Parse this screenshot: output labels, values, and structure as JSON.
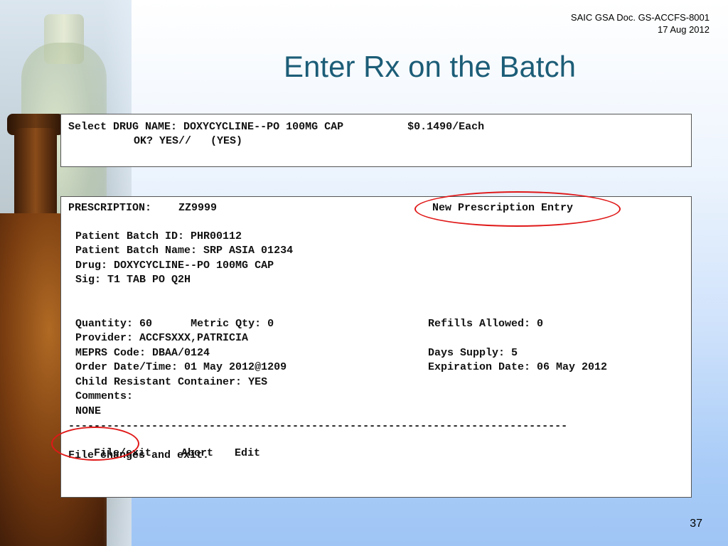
{
  "header": {
    "doc_reference": "SAIC GSA Doc. GS-ACCFS-8001",
    "doc_date": "17 Aug 2012"
  },
  "slide": {
    "title": "Enter Rx on the Batch",
    "page_number": "37"
  },
  "drug_select": {
    "prompt": "Select DRUG NAME:",
    "value": "DOXYCYCLINE--PO 100MG CAP",
    "price": "$0.1490/Each",
    "confirm_prompt": "OK? YES//",
    "confirm_value": "(YES)"
  },
  "prescription": {
    "label": "PRESCRIPTION:",
    "number": "ZZ9999",
    "mode": "New Prescription Entry",
    "fields": [
      {
        "label": "Patient Batch ID:",
        "value": "PHR00112"
      },
      {
        "label": "Patient Batch Name:",
        "value": "SRP ASIA 01234"
      },
      {
        "label": "Drug:",
        "value": "DOXYCYCLINE--PO 100MG CAP"
      },
      {
        "label": "Sig:",
        "value": "T1 TAB PO Q2H"
      }
    ],
    "quantity": {
      "label": "Quantity:",
      "value": "60"
    },
    "metric_qty": {
      "label": "Metric Qty:",
      "value": "0"
    },
    "refills": {
      "label": "Refills Allowed:",
      "value": "0"
    },
    "provider": {
      "label": "Provider:",
      "value": "ACCFSXXX,PATRICIA"
    },
    "meprs": {
      "label": "MEPRS Code:",
      "value": "DBAA/0124"
    },
    "days_supply": {
      "label": "Days Supply:",
      "value": "5"
    },
    "order_date": {
      "label": "Order Date/Time:",
      "value": "01 May 2012@1209"
    },
    "expiration": {
      "label": "Expiration Date:",
      "value": "06 May 2012"
    },
    "child_resistant": {
      "label": "Child Resistant Container:",
      "value": "YES"
    },
    "comments": {
      "label": "Comments:",
      "value": "NONE"
    }
  },
  "menu": {
    "separator": "------------------------------------------------------------------------------",
    "file_exit": "File/exit",
    "abort": "Abort",
    "edit": "Edit",
    "help_text": "File changes and exit."
  },
  "annotation_color": "#e01818",
  "title_color": "#1c5d77"
}
